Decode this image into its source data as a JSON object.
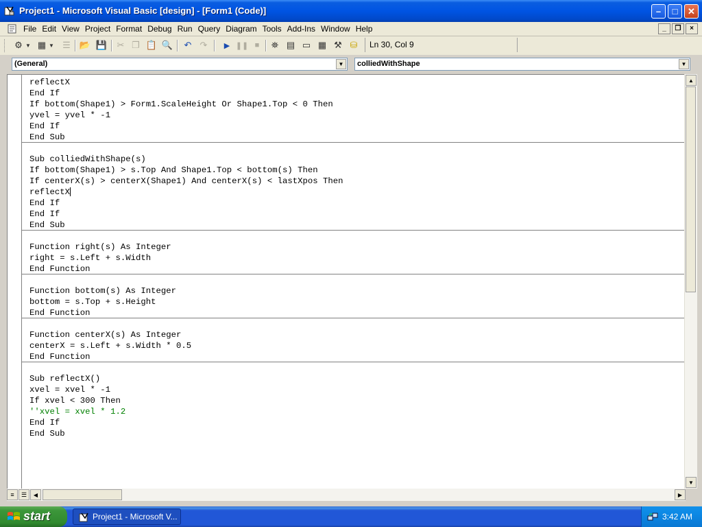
{
  "window": {
    "title": "Project1 - Microsoft Visual Basic [design] - [Form1 (Code)]",
    "caption_buttons": [
      "minimize-icon",
      "maximize-icon",
      "close-icon"
    ]
  },
  "menubar": {
    "items": [
      "File",
      "Edit",
      "View",
      "Project",
      "Format",
      "Debug",
      "Run",
      "Query",
      "Diagram",
      "Tools",
      "Add-Ins",
      "Window",
      "Help"
    ]
  },
  "toolbar": {
    "position": "Ln 30, Col 9"
  },
  "combos": {
    "object": "(General)",
    "procedure": "colliedWithShape"
  },
  "code": {
    "lines": [
      {
        "text": "reflectX"
      },
      {
        "text": "End If"
      },
      {
        "text": "If bottom(Shape1) > Form1.ScaleHeight Or Shape1.Top < 0 Then"
      },
      {
        "text": "yvel = yvel * -1"
      },
      {
        "text": "End If"
      },
      {
        "text": "End Sub",
        "sep": true
      },
      {
        "text": ""
      },
      {
        "text": "Sub colliedWithShape(s)"
      },
      {
        "text": "If bottom(Shape1) > s.Top And Shape1.Top < bottom(s) Then"
      },
      {
        "text": "If centerX(s) > centerX(Shape1) And centerX(s) < lastXpos Then"
      },
      {
        "text": "reflectX",
        "caret": true
      },
      {
        "text": "End If"
      },
      {
        "text": "End If"
      },
      {
        "text": "End Sub",
        "sep": true
      },
      {
        "text": ""
      },
      {
        "text": "Function right(s) As Integer"
      },
      {
        "text": "right = s.Left + s.Width"
      },
      {
        "text": "End Function",
        "sep": true
      },
      {
        "text": ""
      },
      {
        "text": "Function bottom(s) As Integer"
      },
      {
        "text": "bottom = s.Top + s.Height"
      },
      {
        "text": "End Function",
        "sep": true
      },
      {
        "text": ""
      },
      {
        "text": "Function centerX(s) As Integer"
      },
      {
        "text": "centerX = s.Left + s.Width * 0.5"
      },
      {
        "text": "End Function",
        "sep": true
      },
      {
        "text": ""
      },
      {
        "text": "Sub reflectX()"
      },
      {
        "text": "xvel = xvel * -1"
      },
      {
        "text": "If xvel < 300 Then"
      },
      {
        "text": "''xvel = xvel * 1.2",
        "comment": true
      },
      {
        "text": "End If"
      },
      {
        "text": "End Sub"
      }
    ]
  },
  "taskbar": {
    "start_label": "start",
    "task_label": "Project1 - Microsoft V...",
    "clock": "3:42 AM"
  },
  "colors": {
    "titlebar": "#0054e3",
    "comment": "#008000",
    "start": "#308a2f"
  }
}
